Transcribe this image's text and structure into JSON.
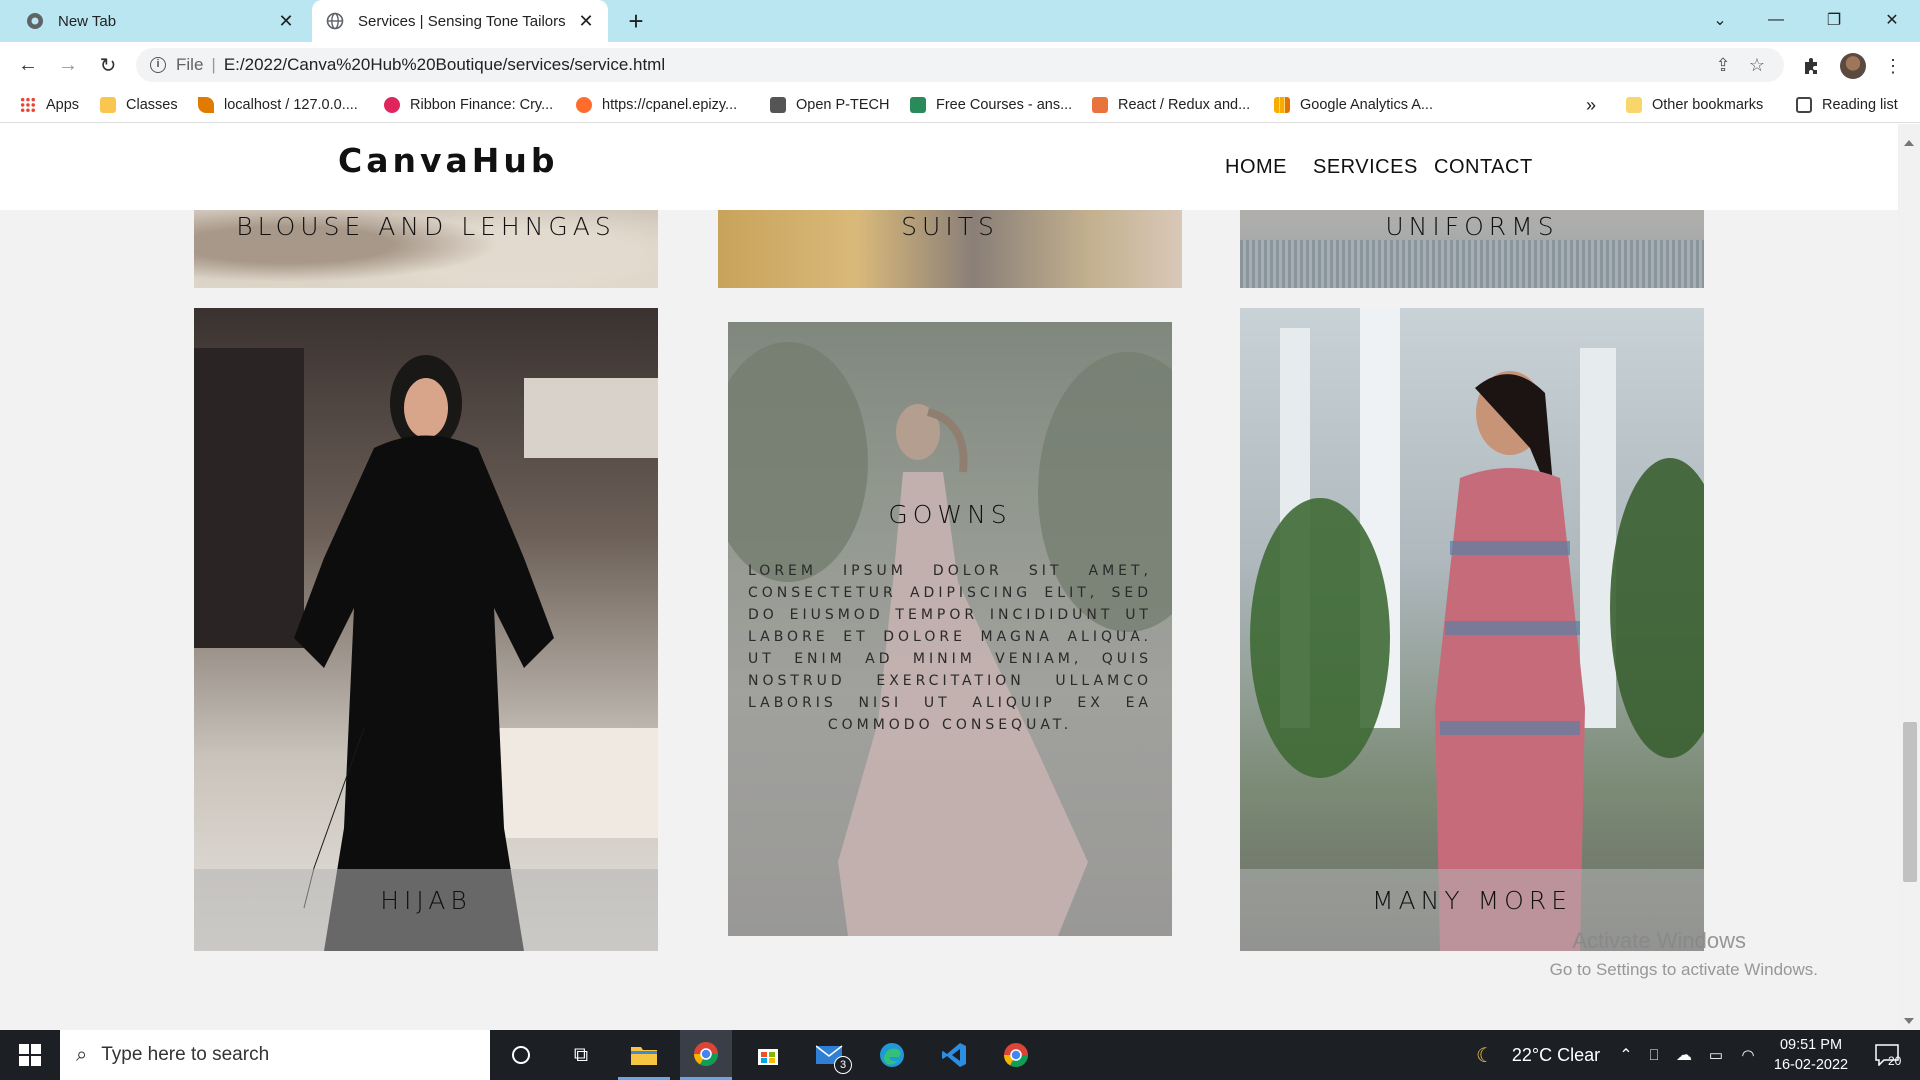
{
  "browser": {
    "tabs": [
      {
        "title": "New Tab",
        "active": false
      },
      {
        "title": "Services | Sensing Tone Tailors",
        "active": true
      }
    ],
    "address": {
      "scheme": "File",
      "url": "E:/2022/Canva%20Hub%20Boutique/services/service.html"
    },
    "bookmarks": [
      {
        "label": "Apps",
        "color": "#1a73e8"
      },
      {
        "label": "Classes",
        "color": "#3c8d3c"
      },
      {
        "label": "localhost / 127.0.0....",
        "color": "#e07b00"
      },
      {
        "label": "Ribbon Finance: Cry...",
        "color": "#e0245e"
      },
      {
        "label": "https://cpanel.epizy...",
        "color": "#ff6c2c"
      },
      {
        "label": "Open P-TECH",
        "color": "#555555"
      },
      {
        "label": "Free Courses - ans...",
        "color": "#2a8a5a"
      },
      {
        "label": "React / Redux and...",
        "color": "#e8733c"
      },
      {
        "label": "Google Analytics A...",
        "color": "#f9ab00"
      }
    ],
    "bookmarks_overflow": "»",
    "other_bookmarks": "Other bookmarks",
    "reading_list": "Reading list"
  },
  "site": {
    "logo": "CanvaHub",
    "nav": [
      "HOME",
      "SERVICES",
      "CONTACT"
    ],
    "top_row_cards": [
      {
        "title": "BLOUSE AND LEHNGAS"
      },
      {
        "title": "SUITS"
      },
      {
        "title": "UNIFORMS"
      }
    ],
    "cards": [
      {
        "title": "HIJAB"
      },
      {
        "title": "GOWNS",
        "description": "Lorem ipsum dolor sit amet, consectetur adipiscing elit, sed do eiusmod tempor incididunt ut labore et dolore magna aliqua. Ut enim ad minim veniam, quis nostrud exercitation ullamco laboris nisi ut aliquip ex ea commodo consequat."
      },
      {
        "title": "MANY MORE"
      }
    ]
  },
  "watermark": {
    "line1": "Activate Windows",
    "line2": "Go to Settings to activate Windows."
  },
  "taskbar": {
    "search_placeholder": "Type here to search",
    "mail_badge": "3",
    "weather": "22°C  Clear",
    "time": "09:51 PM",
    "date": "16-02-2022",
    "notification_count": "20"
  },
  "colors": {
    "tabstrip": "#b9e6f1",
    "page_bg": "#f2f2f2",
    "taskbar": "#1c1f24"
  }
}
